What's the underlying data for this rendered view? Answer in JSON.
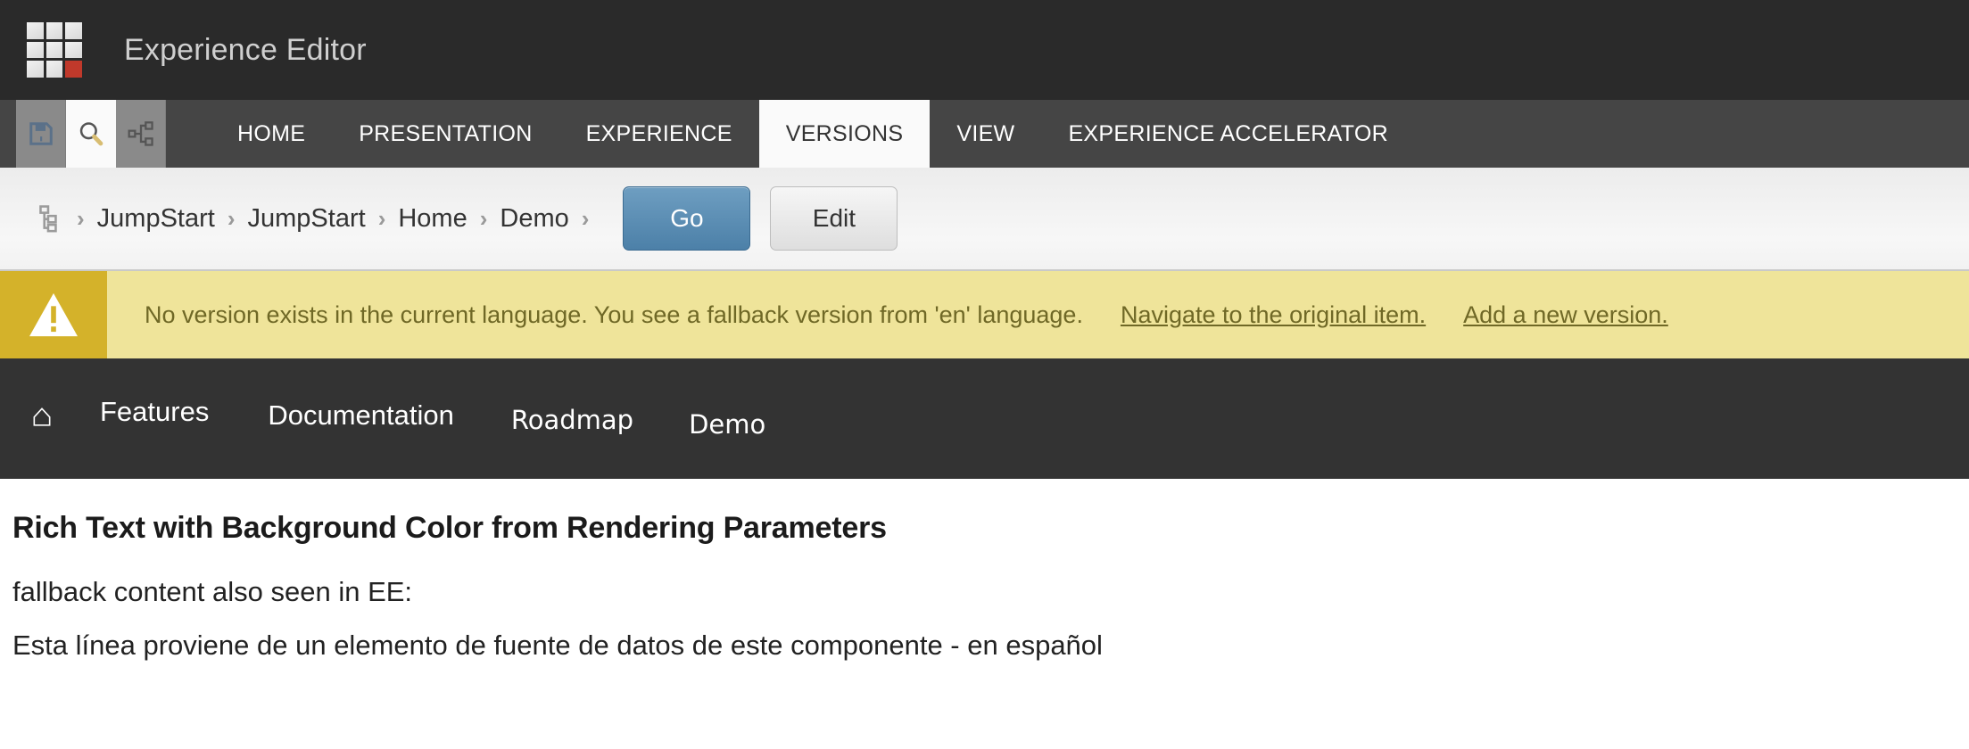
{
  "app": {
    "title": "Experience Editor",
    "logo_icon": "sitecore-grid-logo",
    "logo_accent_color": "#c0392b",
    "header_bg": "#2a2a2a"
  },
  "ribbon": {
    "bg": "#454545",
    "quick_actions": [
      {
        "name": "save",
        "icon": "floppy-disk-icon",
        "active": false
      },
      {
        "name": "search",
        "icon": "magnifier-icon",
        "active": true
      },
      {
        "name": "navigate",
        "icon": "sitemap-icon",
        "active": false
      }
    ],
    "tabs": [
      {
        "label": "HOME",
        "active": false
      },
      {
        "label": "PRESENTATION",
        "active": false
      },
      {
        "label": "EXPERIENCE",
        "active": false
      },
      {
        "label": "VERSIONS",
        "active": true
      },
      {
        "label": "VIEW",
        "active": false
      },
      {
        "label": "EXPERIENCE ACCELERATOR",
        "active": false
      }
    ]
  },
  "breadcrumb": {
    "tree_icon": "content-tree-icon",
    "separator": "›",
    "items": [
      "JumpStart",
      "JumpStart",
      "Home",
      "Demo"
    ],
    "go_label": "Go",
    "edit_label": "Edit",
    "go_color": "#4c80a8"
  },
  "warning": {
    "icon": "warning-triangle-icon",
    "icon_bg": "#d4b22a",
    "bg": "#efe49a",
    "text_color": "#6f6826",
    "message": "No version exists in the current language. You see a fallback version from 'en' language.",
    "links": [
      "Navigate to the original item.",
      "Add a new version."
    ]
  },
  "site_nav": {
    "bg": "#333333",
    "home_icon": "home-icon",
    "items": [
      "Features",
      "Documentation",
      "Roadmap",
      "Demo"
    ]
  },
  "main": {
    "heading": "Rich Text with Background Color from Rendering Parameters",
    "lines": [
      "fallback content also seen in EE:",
      "Esta línea proviene de un elemento de fuente de datos de este componente - en español"
    ]
  }
}
